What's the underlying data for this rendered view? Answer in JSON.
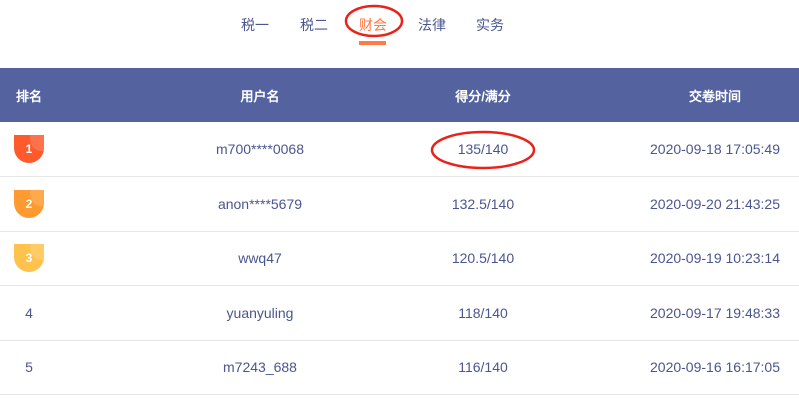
{
  "tabs": [
    {
      "label": "税一"
    },
    {
      "label": "税二"
    },
    {
      "label": "财会",
      "active": true
    },
    {
      "label": "法律"
    },
    {
      "label": "实务"
    }
  ],
  "table": {
    "headers": [
      "排名",
      "用户名",
      "得分/满分",
      "交卷时间"
    ],
    "rows": [
      {
        "rank": "1",
        "user": "m700****0068",
        "score": "135/140",
        "time": "2020-09-18 17:05:49"
      },
      {
        "rank": "2",
        "user": "anon****5679",
        "score": "132.5/140",
        "time": "2020-09-20 21:43:25"
      },
      {
        "rank": "3",
        "user": "wwq47",
        "score": "120.5/140",
        "time": "2020-09-19 10:23:14"
      },
      {
        "rank": "4",
        "user": "yuanyuling",
        "score": "118/140",
        "time": "2020-09-17 19:48:33"
      },
      {
        "rank": "5",
        "user": "m7243_688",
        "score": "116/140",
        "time": "2020-09-16 16:17:05"
      }
    ]
  },
  "colors": {
    "header_bg": "#5463a0",
    "accent": "#ff7a45",
    "badge1": "#ff5a2c",
    "badge2": "#ff9a30",
    "badge3": "#ffc24d",
    "annotation": "#e8241a"
  }
}
